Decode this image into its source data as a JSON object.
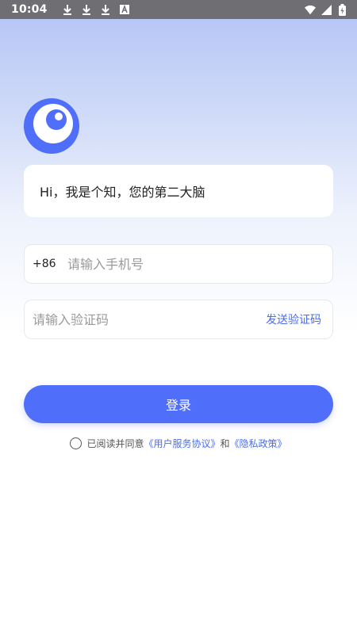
{
  "status_bar": {
    "time": "10:04",
    "left_icons": [
      "download-icon",
      "download-icon",
      "download-icon",
      "font-icon"
    ],
    "right_icons": [
      "wifi-icon",
      "signal-icon",
      "battery-icon"
    ]
  },
  "greeting": "Hi，我是个知，您的第二大脑",
  "phone": {
    "country_code": "+86",
    "placeholder": "请输入手机号"
  },
  "code": {
    "placeholder": "请输入验证码",
    "send_label": "发送验证码"
  },
  "login_label": "登录",
  "agreement": {
    "prefix": "已阅读并同意",
    "terms_link": "《用户服务协议》",
    "conjunction": "和",
    "privacy_link": "《隐私政策》"
  },
  "colors": {
    "accent": "#4f6ffb",
    "link": "#4a6cf0",
    "status_bar": "#6f6f73"
  }
}
